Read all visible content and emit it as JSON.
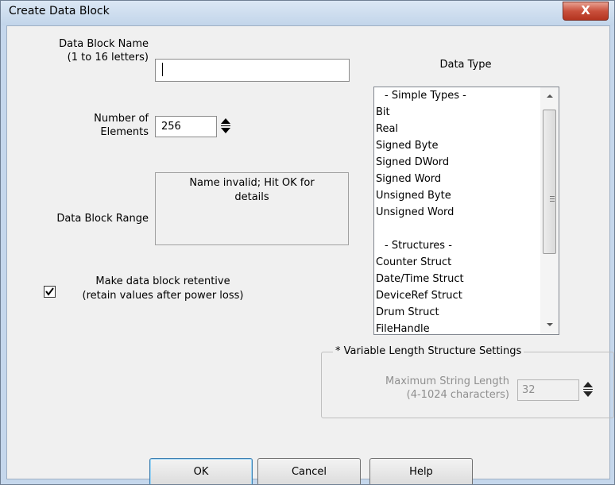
{
  "window": {
    "title": "Create Data Block",
    "close_glyph": "X"
  },
  "fields": {
    "name_label": "Data Block Name\n(1 to 16 letters)",
    "name_value": "",
    "elements_label": "Number of\nElements",
    "elements_value": "256",
    "range_label": "Data Block Range",
    "range_message": "Name invalid; Hit OK for details"
  },
  "retentive": {
    "checked": true,
    "label": "Make data block retentive\n(retain values after power loss)"
  },
  "data_type": {
    "title": "Data Type",
    "items": [
      "- Simple Types -",
      "Bit",
      "Real",
      "Signed Byte",
      "Signed DWord",
      "Signed Word",
      "Unsigned Byte",
      "Unsigned Word",
      "",
      "- Structures -",
      "Counter Struct",
      "Date/Time Struct",
      "DeviceRef Struct",
      "Drum Struct",
      "FileHandle"
    ]
  },
  "variable_length": {
    "title": "* Variable Length Structure Settings",
    "max_label": "Maximum String Length\n(4-1024 characters)",
    "max_value": "32"
  },
  "buttons": {
    "ok": "OK",
    "cancel": "Cancel",
    "help": "Help"
  },
  "colors": {
    "titlebar": "#c5d7ec",
    "close_button": "#c9503c",
    "dialog_bg": "#f0f0f0"
  }
}
